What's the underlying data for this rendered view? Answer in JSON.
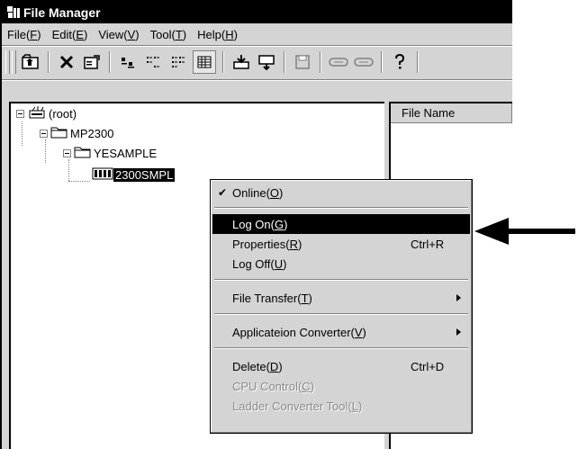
{
  "window": {
    "title": "File Manager"
  },
  "menubar": {
    "items": [
      {
        "text": "File(",
        "key": "F",
        "end": ")"
      },
      {
        "text": "Edit(",
        "key": "E",
        "end": ")"
      },
      {
        "text": "View(",
        "key": "V",
        "end": ")"
      },
      {
        "text": "Tool(",
        "key": "T",
        "end": ")"
      },
      {
        "text": "Help(",
        "key": "H",
        "end": ")"
      }
    ]
  },
  "toolbar": {
    "buttons": [
      "up-folder-icon",
      "delete-icon",
      "properties-icon",
      "large-icons-icon",
      "small-icons-icon",
      "list-view-icon",
      "details-view-icon",
      "download-icon",
      "transfer-icon",
      "save-icon",
      "link-icon",
      "link2-icon",
      "help-icon"
    ]
  },
  "tree": {
    "nodes": [
      {
        "label": "(root)",
        "icon": "network-root-icon"
      },
      {
        "label": "MP2300",
        "icon": "folder-icon"
      },
      {
        "label": "YESAMPLE",
        "icon": "folder-icon"
      },
      {
        "label": "2300SMPL",
        "icon": "cpu-module-icon",
        "selected": true
      }
    ]
  },
  "list": {
    "column_header": "File Name"
  },
  "context_menu": {
    "online": {
      "text": "Online(",
      "key": "O",
      "end": ")",
      "checked": true
    },
    "logon": {
      "text": "Log On(",
      "key": "G",
      "end": ")"
    },
    "properties": {
      "text": "Properties(",
      "key": "R",
      "end": ")",
      "shortcut": "Ctrl+R"
    },
    "logoff": {
      "text": "Log Off(",
      "key": "U",
      "end": ")"
    },
    "file_transfer": {
      "text": "File Transfer(",
      "key": "T",
      "end": ")"
    },
    "app_converter": {
      "text": "Applicateion Converter(",
      "key": "V",
      "end": ")"
    },
    "delete": {
      "text": "Delete(",
      "key": "D",
      "end": ")",
      "shortcut": "Ctrl+D"
    },
    "cpu_control": {
      "text": "CPU Control(",
      "key": "C",
      "end": ")"
    },
    "ladder_converter": {
      "text": "Ladder Converter Tool(",
      "key": "L",
      "end": ")"
    }
  },
  "colors": {
    "highlight": "#000000",
    "face": "#d4d4d4",
    "disabled_text": "#8a8a8a"
  }
}
